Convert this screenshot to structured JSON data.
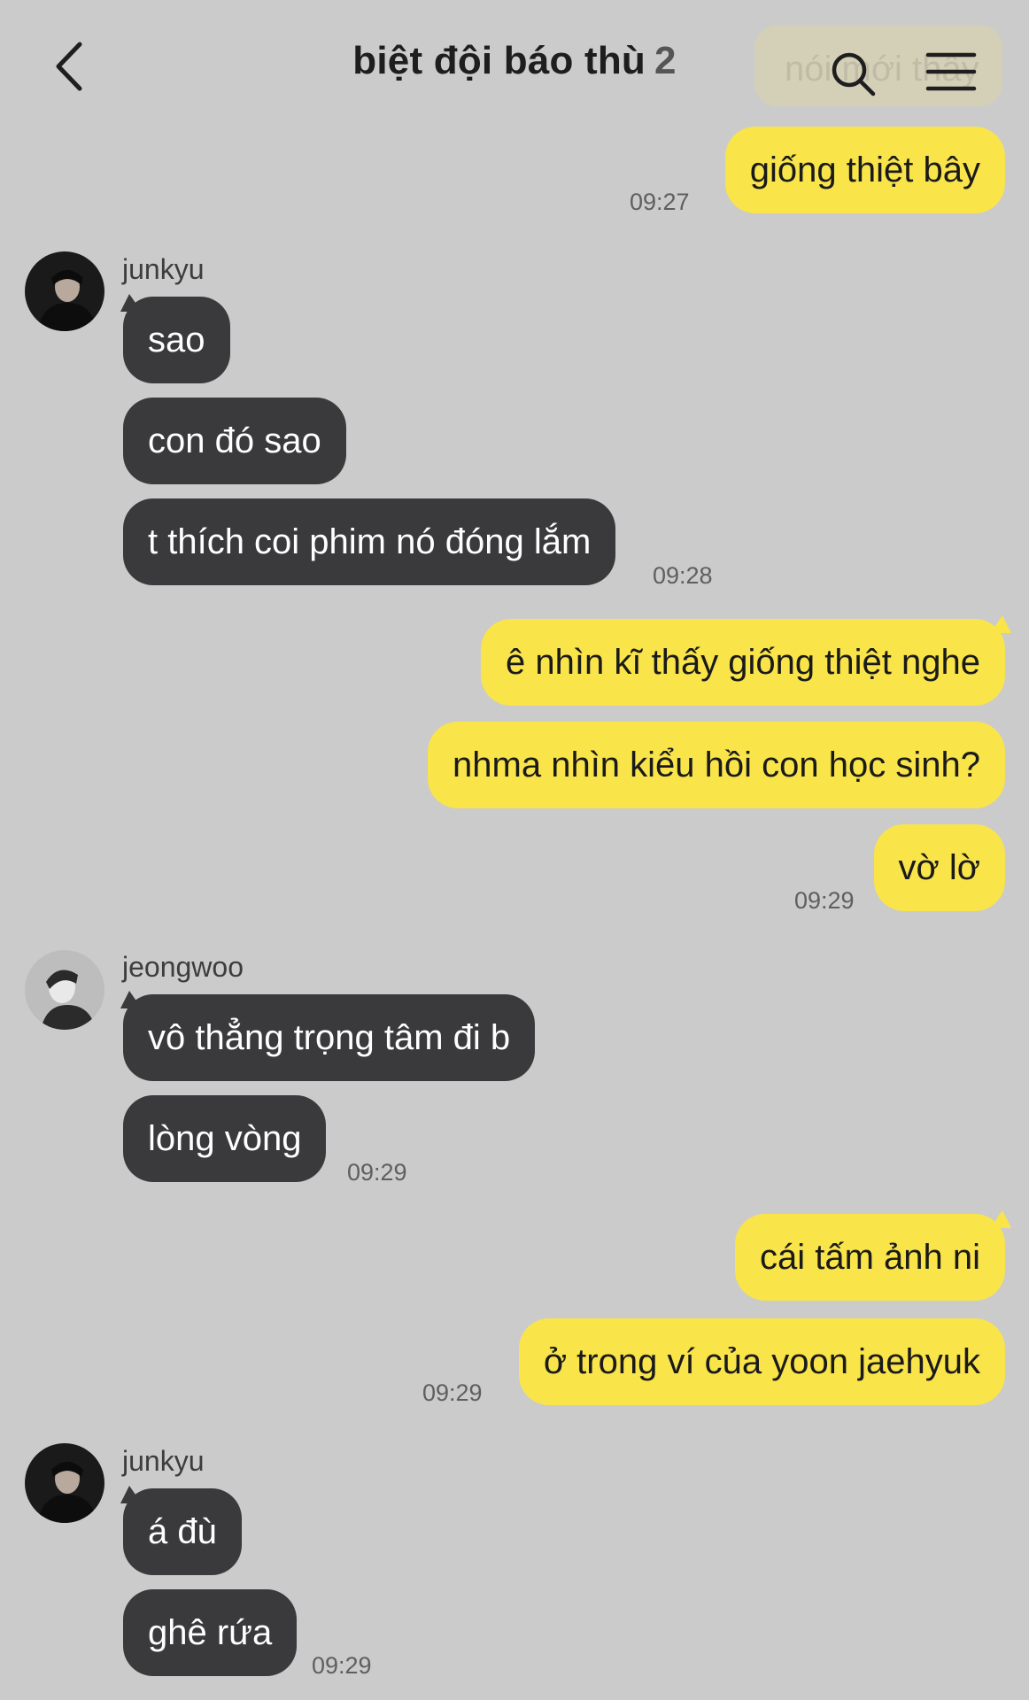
{
  "header": {
    "title": "biệt đội báo thù",
    "member_count": "2",
    "back_icon": "chevron-left-icon",
    "search_icon": "search-icon",
    "menu_icon": "hamburger-menu-icon"
  },
  "overlay": {
    "ghost_text": "nói mới thấy"
  },
  "colors": {
    "background": "#cbcbcb",
    "my_bubble": "#f9e44a",
    "their_bubble": "#3a3a3c"
  },
  "messages": [
    {
      "from": "me",
      "text": "giống thiệt bây",
      "time": "09:27"
    },
    {
      "from": "junkyu",
      "sender_label": "junkyu",
      "texts": [
        "sao",
        "con đó sao",
        "t thích coi phim nó đóng lắm"
      ],
      "time": "09:28"
    },
    {
      "from": "me",
      "texts": [
        "ê nhìn kĩ thấy giống thiệt nghe",
        "nhma nhìn kiểu hồi con học sinh?",
        "vờ lờ"
      ],
      "time": "09:29"
    },
    {
      "from": "jeongwoo",
      "sender_label": "jeongwoo",
      "texts": [
        "vô thẳng trọng tâm đi b",
        "lòng vòng"
      ],
      "time": "09:29"
    },
    {
      "from": "me",
      "texts": [
        "cái tấm ảnh ni",
        "ở trong ví của yoon jaehyuk"
      ],
      "time": "09:29"
    },
    {
      "from": "junkyu",
      "sender_label": "junkyu",
      "texts": [
        "á đù",
        "ghê rứa"
      ],
      "time": "09:29"
    }
  ]
}
